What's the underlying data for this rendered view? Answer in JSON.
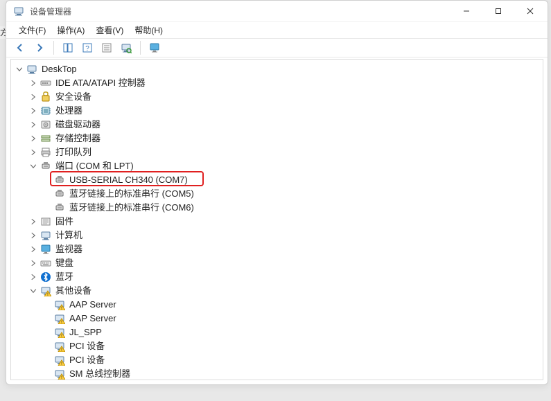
{
  "window": {
    "title": "设备管理器",
    "buttons": {
      "min": "—",
      "max": "▢",
      "close": "✕"
    }
  },
  "menu": {
    "file": "文件(F)",
    "action": "操作(A)",
    "view": "查看(V)",
    "help": "帮助(H)"
  },
  "toolbar_icons": [
    "back",
    "forward",
    "sep",
    "list",
    "help",
    "details",
    "scan",
    "sep",
    "monitor"
  ],
  "tree": {
    "root": {
      "label": "DeskTop",
      "expanded": true,
      "icon": "computer"
    },
    "children": [
      {
        "label": "IDE ATA/ATAPI 控制器",
        "icon": "ide",
        "expanded": false
      },
      {
        "label": "安全设备",
        "icon": "security",
        "expanded": false
      },
      {
        "label": "处理器",
        "icon": "cpu",
        "expanded": false
      },
      {
        "label": "磁盘驱动器",
        "icon": "disk",
        "expanded": false
      },
      {
        "label": "存储控制器",
        "icon": "storage",
        "expanded": false
      },
      {
        "label": "打印队列",
        "icon": "printer",
        "expanded": false
      },
      {
        "label": "端口 (COM 和 LPT)",
        "icon": "port",
        "expanded": true,
        "children": [
          {
            "label": "USB-SERIAL CH340 (COM7)",
            "icon": "port",
            "highlighted": true
          },
          {
            "label": "蓝牙链接上的标准串行 (COM5)",
            "icon": "port"
          },
          {
            "label": "蓝牙链接上的标准串行 (COM6)",
            "icon": "port"
          }
        ]
      },
      {
        "label": "固件",
        "icon": "firmware",
        "expanded": false
      },
      {
        "label": "计算机",
        "icon": "computer",
        "expanded": false
      },
      {
        "label": "监视器",
        "icon": "monitor",
        "expanded": false
      },
      {
        "label": "键盘",
        "icon": "keyboard",
        "expanded": false
      },
      {
        "label": "蓝牙",
        "icon": "bluetooth",
        "expanded": false
      },
      {
        "label": "其他设备",
        "icon": "warn",
        "expanded": true,
        "children": [
          {
            "label": "AAP Server",
            "icon": "warn"
          },
          {
            "label": "AAP Server",
            "icon": "warn"
          },
          {
            "label": "JL_SPP",
            "icon": "warn"
          },
          {
            "label": "PCI 设备",
            "icon": "warn"
          },
          {
            "label": "PCI 设备",
            "icon": "warn"
          },
          {
            "label": "SM 总线控制器",
            "icon": "warn"
          }
        ]
      }
    ]
  }
}
